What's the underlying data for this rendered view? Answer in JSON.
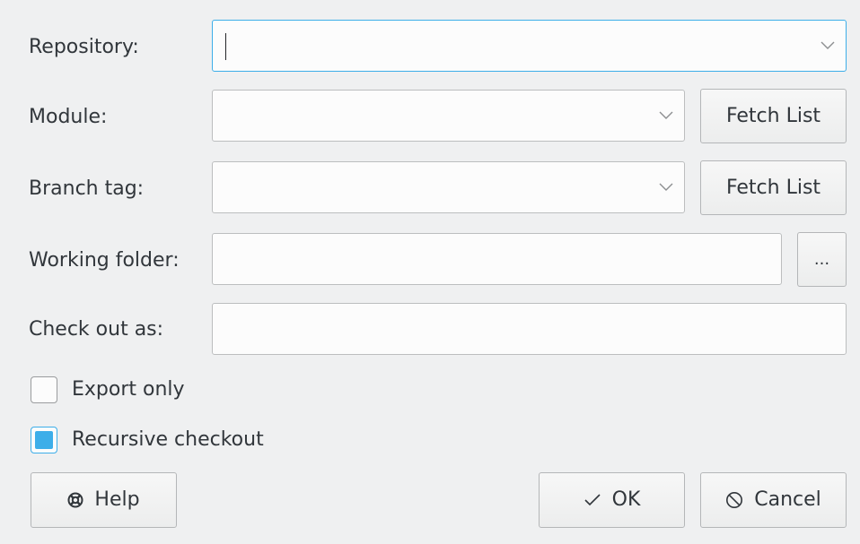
{
  "form": {
    "repository": {
      "label": "Repository:",
      "value": ""
    },
    "module": {
      "label": "Module:",
      "value": "",
      "fetch_label": "Fetch List"
    },
    "branch_tag": {
      "label": "Branch tag:",
      "value": "",
      "fetch_label": "Fetch List"
    },
    "working_folder": {
      "label": "Working folder:",
      "value": "",
      "browse_label": "..."
    },
    "check_out_as": {
      "label": "Check out as:",
      "value": ""
    }
  },
  "options": {
    "export_only": {
      "label": "Export only",
      "checked": false
    },
    "recursive_checkout": {
      "label": "Recursive checkout",
      "checked": true
    }
  },
  "buttons": {
    "help": "Help",
    "ok": "OK",
    "cancel": "Cancel"
  },
  "icons": {
    "help": "lifebuoy-icon",
    "ok": "checkmark-icon",
    "cancel": "cancel-circle-icon",
    "dropdown": "chevron-down-icon"
  },
  "colors": {
    "background": "#eff0f1",
    "accent": "#3daee9",
    "text": "#31363b"
  }
}
